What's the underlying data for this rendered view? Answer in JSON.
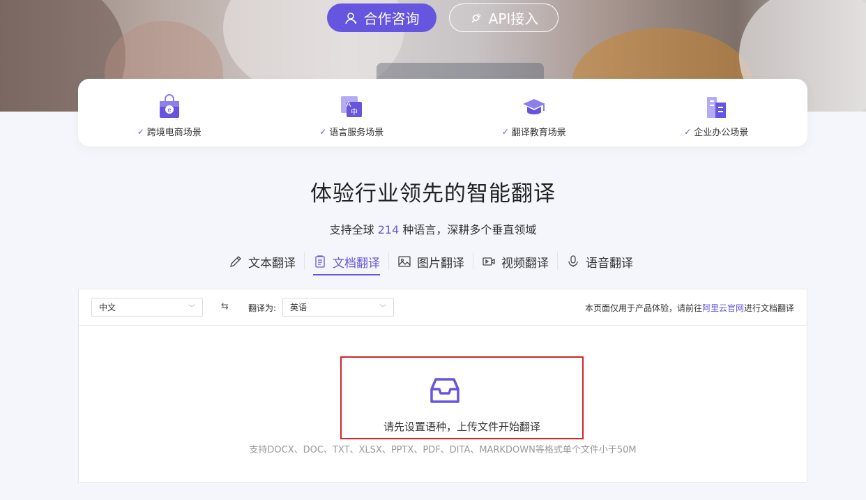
{
  "hero": {
    "consult_label": "合作咨询",
    "api_label": "API接入"
  },
  "scenarios": [
    {
      "label": "跨境电商场景",
      "icon": "shopping-bag-icon"
    },
    {
      "label": "语言服务场景",
      "icon": "language-translate-icon"
    },
    {
      "label": "翻译教育场景",
      "icon": "graduation-cap-icon"
    },
    {
      "label": "企业办公场景",
      "icon": "office-building-icon"
    }
  ],
  "headline": {
    "title": "体验行业领先的智能翻译",
    "sub_prefix": "支持全球",
    "sub_count": "214",
    "sub_suffix": "种语言，深耕多个垂直领域"
  },
  "tabs": [
    {
      "label": "文本翻译",
      "icon": "pencil-icon",
      "active": false
    },
    {
      "label": "文档翻译",
      "icon": "document-icon",
      "active": true
    },
    {
      "label": "图片翻译",
      "icon": "image-icon",
      "active": false
    },
    {
      "label": "视频翻译",
      "icon": "video-icon",
      "active": false
    },
    {
      "label": "语音翻译",
      "icon": "microphone-icon",
      "active": false
    }
  ],
  "panel": {
    "source_language": "中文",
    "swap_symbol": "⇆",
    "target_prefix": "翻译为:",
    "target_language": "英语",
    "notice_prefix": "本页面仅用于产品体验，请前往",
    "notice_link": "阿里云官网",
    "notice_suffix": "进行文档翻译",
    "upload_prompt": "请先设置语种，上传文件开始翻译",
    "formats_note": "支持DOCX、DOC、TXT、XLSX、PPTX、PDF、DITA、MARKDOWN等格式单个文件小于50M"
  },
  "colors": {
    "accent": "#6655de",
    "highlight_border": "#d4242a"
  }
}
